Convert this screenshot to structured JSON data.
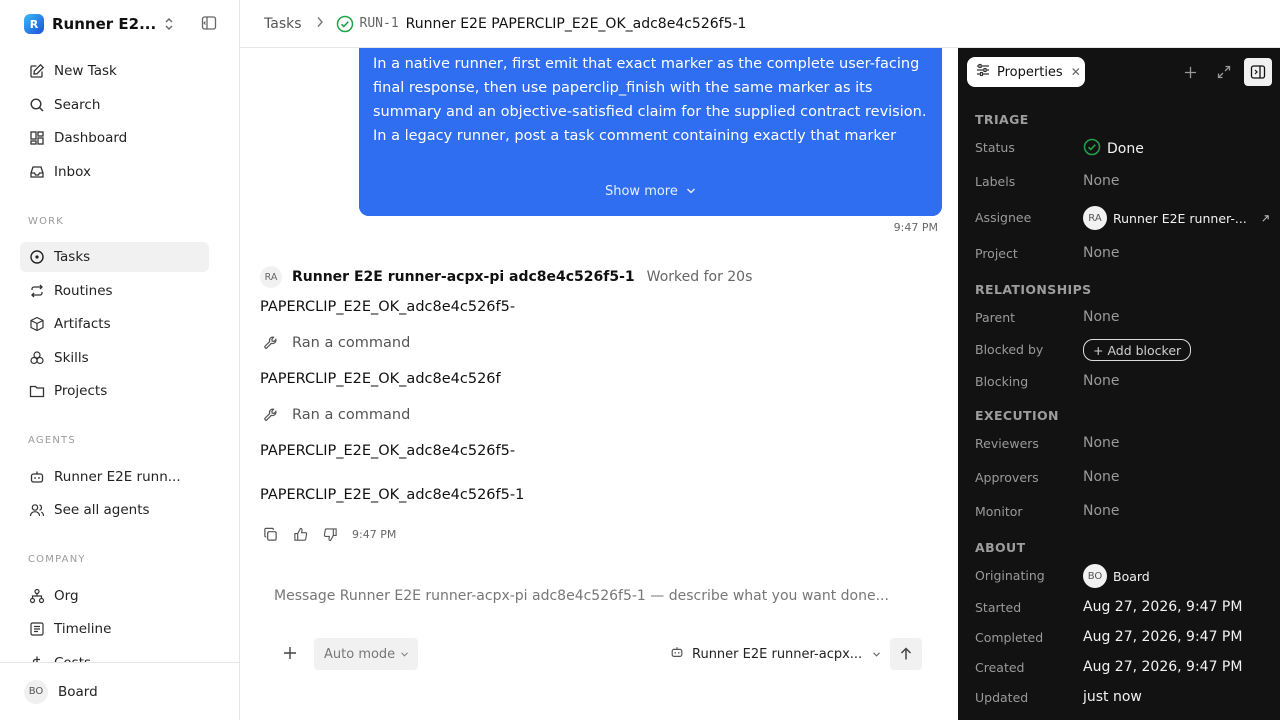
{
  "workspace": {
    "name": "Runner E2...",
    "logo_letter": "R"
  },
  "nav": {
    "new_task": "New Task",
    "search": "Search",
    "dashboard": "Dashboard",
    "inbox": "Inbox"
  },
  "work": {
    "label": "WORK",
    "items": [
      "Tasks",
      "Routines",
      "Artifacts",
      "Skills",
      "Projects"
    ]
  },
  "agents": {
    "label": "AGENTS",
    "runner": "Runner E2E runn...",
    "see_all": "See all agents"
  },
  "company": {
    "label": "COMPANY",
    "items": [
      "Org",
      "Timeline",
      "Costs"
    ]
  },
  "user": {
    "initials": "BO",
    "name": "Board"
  },
  "header": {
    "breadcrumb": "Tasks",
    "run_id": "RUN-1",
    "title": "Runner E2E PAPERCLIP_E2E_OK_adc8e4c526f5-1"
  },
  "thread": {
    "user_message_lines": [
      "In a native runner, first emit that exact marker as the complete user-facing final response, then use paperclip_finish with the same marker as its summary and an objective-satisfied claim for the supplied contract revision.",
      "In a legacy runner, post a task comment containing exactly that marker"
    ],
    "show_more": "Show more",
    "user_time": "9:47 PM",
    "agent_initials": "RA",
    "agent_name": "Runner E2E runner-acpx-pi adc8e4c526f5-1",
    "worked_for": "Worked for 20s",
    "outputs": [
      "PAPERCLIP_E2E_OK_adc8e4c526f5-",
      "PAPERCLIP_E2E_OK_adc8e4c526f",
      "PAPERCLIP_E2E_OK_adc8e4c526f5-",
      "PAPERCLIP_E2E_OK_adc8e4c526f5-1"
    ],
    "command_label": "Ran a command",
    "agent_time": "9:47 PM"
  },
  "composer": {
    "placeholder": "Message Runner E2E runner-acpx-pi adc8e4c526f5-1 — describe what you want done...",
    "mode": "Auto mode",
    "agent": "Runner E2E runner-acpx..."
  },
  "properties": {
    "tab": "Properties",
    "triage": {
      "title": "TRIAGE",
      "status_label": "Status",
      "status": "Done",
      "labels_label": "Labels",
      "labels": "None",
      "assignee_label": "Assignee",
      "assignee_initials": "RA",
      "assignee": "Runner E2E runner-...",
      "project_label": "Project",
      "project": "None"
    },
    "relationships": {
      "title": "RELATIONSHIPS",
      "parent_label": "Parent",
      "parent": "None",
      "blocked_by_label": "Blocked by",
      "add_blocker": "+ Add blocker",
      "blocking_label": "Blocking",
      "blocking": "None"
    },
    "execution": {
      "title": "EXECUTION",
      "reviewers_label": "Reviewers",
      "reviewers": "None",
      "approvers_label": "Approvers",
      "approvers": "None",
      "monitor_label": "Monitor",
      "monitor": "None"
    },
    "about": {
      "title": "ABOUT",
      "originating_label": "Originating",
      "originating_initials": "BO",
      "originating": "Board",
      "started_label": "Started",
      "started": "Aug 27, 2026, 9:47 PM",
      "completed_label": "Completed",
      "completed": "Aug 27, 2026, 9:47 PM",
      "created_label": "Created",
      "created": "Aug 27, 2026, 9:47 PM",
      "updated_label": "Updated",
      "updated": "just now"
    }
  },
  "colors": {
    "accent": "#2f6ef0",
    "success": "#22a34a",
    "panel_bg": "#121212"
  }
}
